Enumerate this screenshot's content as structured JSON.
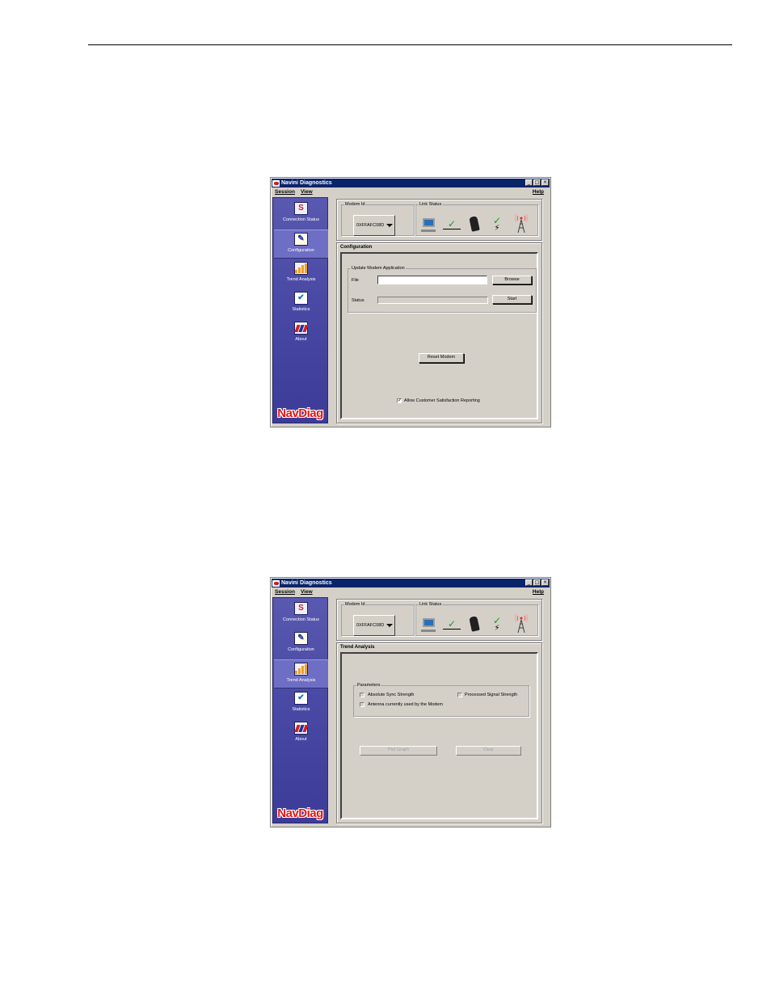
{
  "windows": [
    {
      "title": "Navini Diagnostics",
      "winbtns": {
        "minimize": "_",
        "maximize": "□",
        "close": "×"
      },
      "menu": {
        "session": "Session",
        "view": "View",
        "help": "Help"
      },
      "nav": [
        {
          "label": "Connection Status"
        },
        {
          "label": "Configuration"
        },
        {
          "label": "Trend Analysis"
        },
        {
          "label": "Statistics"
        },
        {
          "label": "About"
        }
      ],
      "active_nav": "Configuration",
      "logo": "NavDiag",
      "modem_id": {
        "legend": "Modem Id",
        "value": "0XFFAFC08D"
      },
      "link_status": {
        "legend": "Link Status",
        "pc_to_modem": "ok",
        "modem_to_tower": "ok"
      },
      "panel": {
        "title": "Configuration",
        "update_group": "Update Modem Application",
        "file_label": "File",
        "file_value": "",
        "browse_button": "Browse",
        "status_label": "Status",
        "start_button": "Start",
        "reset_button": "Reset Modem",
        "reporting_checkbox": {
          "label": "Allow Customer Satisfaction Reporting",
          "checked": true
        }
      }
    },
    {
      "title": "Navini Diagnostics",
      "winbtns": {
        "minimize": "_",
        "maximize": "□",
        "close": "×"
      },
      "menu": {
        "session": "Session",
        "view": "View",
        "help": "Help"
      },
      "nav": [
        {
          "label": "Connection Status"
        },
        {
          "label": "Configuration"
        },
        {
          "label": "Trend Analysis"
        },
        {
          "label": "Statistics"
        },
        {
          "label": "About"
        }
      ],
      "active_nav": "Trend Analysis",
      "logo": "NavDiag",
      "modem_id": {
        "legend": "Modem Id",
        "value": "0XFFAFC08D"
      },
      "link_status": {
        "legend": "Link Status",
        "pc_to_modem": "ok",
        "modem_to_tower": "ok"
      },
      "panel": {
        "title": "Trend Analysis",
        "parameters_group": "Parameters",
        "options": {
          "absolute_sync": "Absolute Sync Strength",
          "processed_signal": "Processed Signal Strength",
          "antenna": "Antenna currently used by the Modem"
        },
        "plot_button": "Plot Graph",
        "clear_button": "Clear"
      }
    }
  ],
  "colors": {
    "titlebar": "#0a246a",
    "sidebar": "#4a4aa6",
    "logo": "#e11818",
    "check": "#1a9a1a",
    "window_bg": "#d4d0c8"
  }
}
